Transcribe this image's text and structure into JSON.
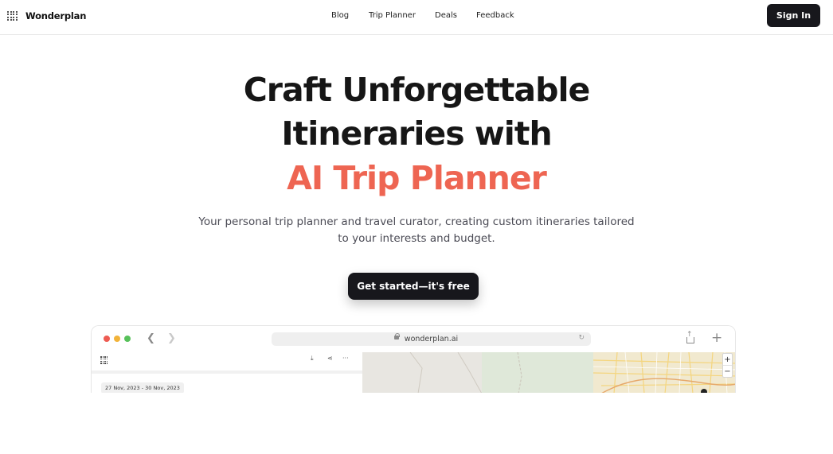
{
  "brand": {
    "name": "Wonderplan",
    "icon": "dot-grid-logo-icon"
  },
  "nav": {
    "links": [
      "Blog",
      "Trip Planner",
      "Deals",
      "Feedback"
    ],
    "sign_in": "Sign In"
  },
  "hero": {
    "title_line1": "Craft Unforgettable",
    "title_line2": "Itineraries with",
    "title_highlight": "AI Trip Planner",
    "subtitle_line1": "Your personal trip planner and travel curator, creating custom itineraries tailored",
    "subtitle_line2": "to your interests and budget.",
    "cta": "Get started—it's free"
  },
  "preview": {
    "url": "wonderplan.ai",
    "date_range": "27 Nov, 2023 - 30 Nov, 2023",
    "zoom_in": "+",
    "zoom_out": "−"
  },
  "colors": {
    "accent": "#ee6552",
    "dark": "#17171c",
    "text_muted": "#4b4b55"
  }
}
